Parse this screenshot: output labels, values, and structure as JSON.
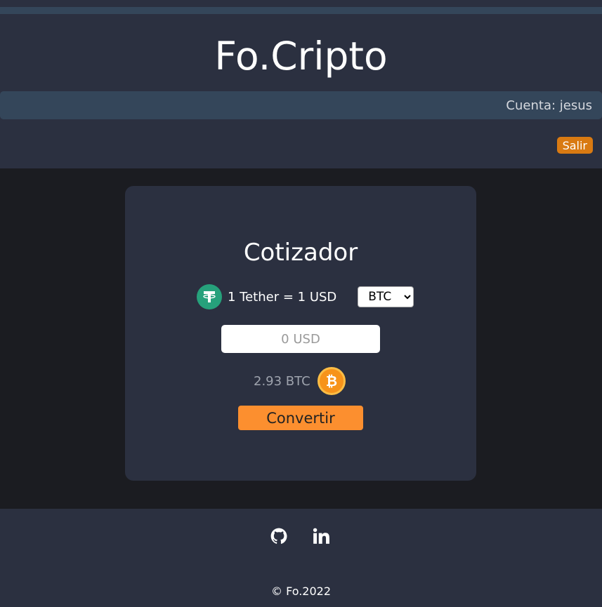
{
  "header": {
    "site_title": "Fo.Cripto",
    "account_label": "Cuenta: jesus",
    "logout_label": "Salir"
  },
  "converter": {
    "title": "Cotizador",
    "rate_text": "1 Tether = 1 USD",
    "currency_options": [
      "BTC"
    ],
    "selected_currency": "BTC",
    "amount_placeholder": "0 USD",
    "result_text": "2.93 BTC",
    "convert_label": "Convertir",
    "icons": [
      "tether-icon",
      "bitcoin-icon"
    ]
  },
  "footer": {
    "social_icons": [
      "github-icon",
      "linkedin-icon"
    ],
    "copyright": "© Fo.2022"
  },
  "colors": {
    "header_bg": "#2b3040",
    "body_bg": "#1b1c21",
    "account_bar_bg": "#34465a",
    "logout_bg": "#d97a12",
    "convert_bg": "#fc8f2f",
    "tether": "#26a17b",
    "bitcoin": "#f7931a"
  }
}
